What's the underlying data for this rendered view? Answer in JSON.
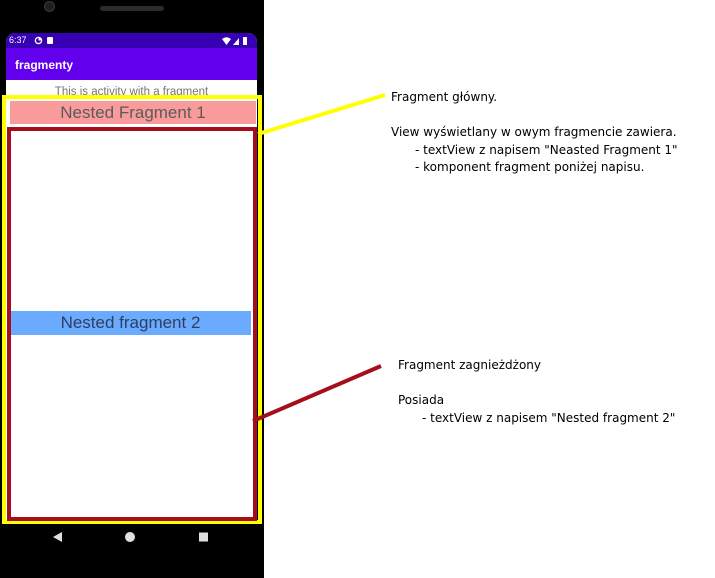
{
  "phone": {
    "status_time": "6:37",
    "app_title": "fragmenty",
    "activity_text": "This is activity with a fragment",
    "fragment1_label": "Nested Fragment 1",
    "fragment2_label": "Nested fragment 2"
  },
  "colors": {
    "app_bar": "#6200ee",
    "status_bar": "#3700b3",
    "fragment1_bg": "#fa9b9b",
    "fragment2_bg": "#6aaaff",
    "outer_highlight": "#ffff00",
    "inner_highlight": "#a50f1c"
  },
  "annotation_main": {
    "title": "Fragment główny.",
    "description": "View wyświetlany w owym fragmencie zawiera.",
    "items": [
      "- textView z napisem \"Neasted Fragment 1\"",
      "- komponent fragment poniżej napisu."
    ]
  },
  "annotation_nested": {
    "title": "Fragment zagnieżdżony",
    "description": "Posiada",
    "items": [
      "- textView z napisem \"Nested fragment 2\""
    ]
  }
}
